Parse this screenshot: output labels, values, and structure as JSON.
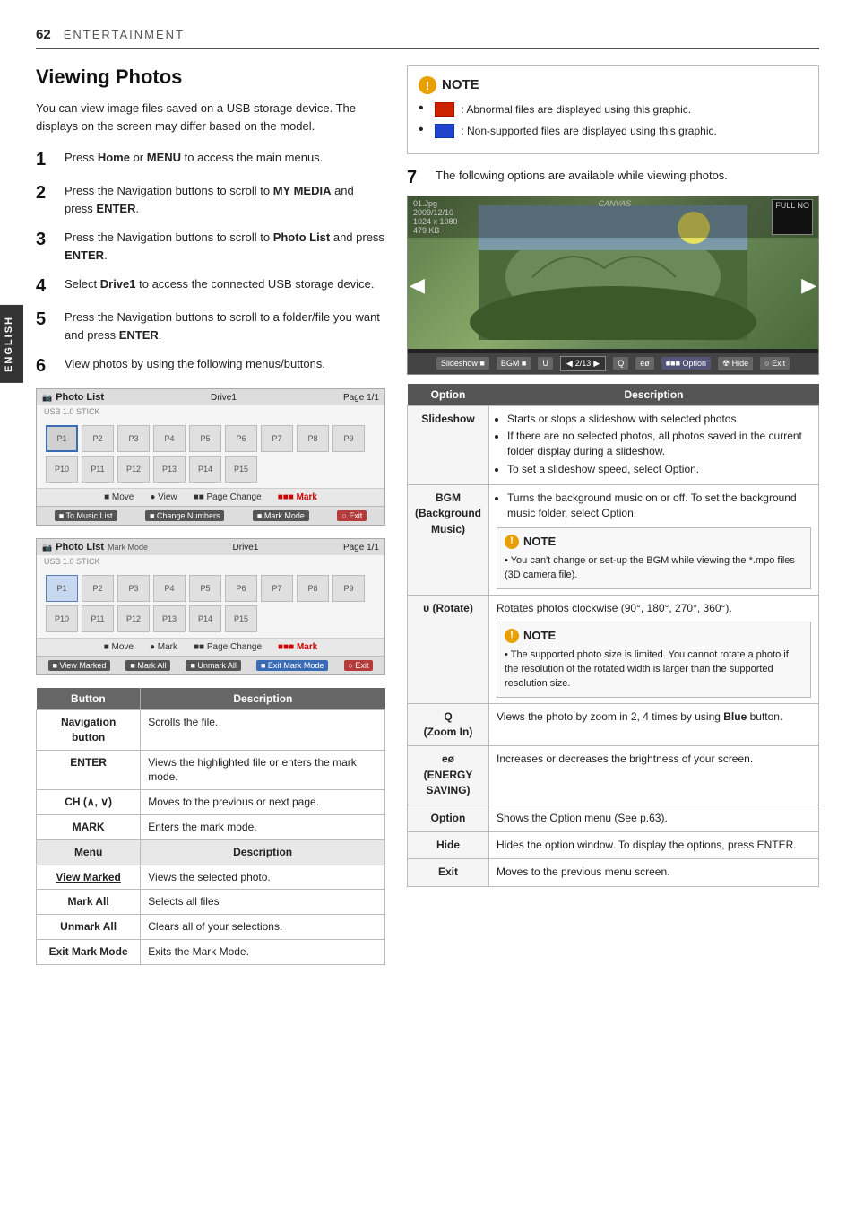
{
  "page": {
    "number": "62",
    "section": "ENTERTAINMENT",
    "english_tab": "ENGLISH"
  },
  "heading": "Viewing Photos",
  "intro": "You can view image files saved on a USB storage device. The displays on the screen may differ based on the model.",
  "steps": [
    {
      "num": "1",
      "text": "Press Home or MENU to access the main menus."
    },
    {
      "num": "2",
      "text": "Press the Navigation buttons to scroll to MY MEDIA and press ENTER."
    },
    {
      "num": "3",
      "text": "Press the Navigation buttons to scroll to Photo List and press ENTER."
    },
    {
      "num": "4",
      "text": "Select Drive1 to access the connected USB storage device."
    },
    {
      "num": "5",
      "text": "Press the Navigation buttons to scroll to a folder/file you want and press ENTER."
    },
    {
      "num": "6",
      "text": "View photos by using the following menus/buttons."
    }
  ],
  "photo_list_ui": {
    "title": "Photo List",
    "mode_label": "Mark Mode",
    "drive": "Drive1",
    "page": "Page 1/1",
    "thumbs": [
      "P1",
      "P2",
      "P3",
      "P4",
      "P5",
      "P6",
      "P7",
      "P8",
      "P9",
      "P10",
      "P11",
      "P12",
      "P13",
      "P14",
      "P15"
    ],
    "nav_items": [
      "Move",
      "View",
      "Page Change",
      "Mark"
    ],
    "buttons_1": [
      "To Music List",
      "Change Numbers",
      "Mark Mode",
      "Exit"
    ],
    "buttons_2": [
      "View Marked",
      "Mark All",
      "Unmark All",
      "Exit Mark Mode",
      "Exit"
    ]
  },
  "button_table": {
    "col1": "Button",
    "col2": "Description",
    "rows": [
      {
        "button": "Navigation button",
        "desc": "Scrolls the file."
      },
      {
        "button": "ENTER",
        "desc": "Views the highlighted file or enters the mark mode."
      },
      {
        "button": "CH (∧, ∨)",
        "desc": "Moves to the previous or next page."
      },
      {
        "button": "MARK",
        "desc": "Enters the mark mode."
      }
    ],
    "menu_col1": "Menu",
    "menu_col2": "Description",
    "menu_rows": [
      {
        "menu": "View Marked",
        "desc": "Views the selected photo."
      },
      {
        "menu": "Mark All",
        "desc": "Selects all files"
      },
      {
        "menu": "Unmark All",
        "desc": "Clears all of your selections."
      },
      {
        "menu": "Exit Mark Mode",
        "desc": "Exits the Mark Mode."
      }
    ]
  },
  "note": {
    "title": "NOTE",
    "bullets": [
      "Abnormal files are displayed using this graphic.",
      "Non-supported files are displayed using this graphic."
    ]
  },
  "step7_text": "The following options are available while viewing photos.",
  "viewer": {
    "file_info": "01.Jpg\n2009/12/10\n1024 x 1080\n479 KB",
    "counter": "2/13",
    "toolbar_items": [
      "Slideshow",
      "BGM",
      "U",
      "Q",
      "eø",
      "Option",
      "Hide",
      "Exit"
    ],
    "full_no": "FULL NO",
    "canvas_text": "CANVAS"
  },
  "options_table": {
    "col1": "Option",
    "col2": "Description",
    "rows": [
      {
        "option": "Slideshow",
        "desc_bullets": [
          "Starts or stops a slideshow with selected photos.",
          "If there are no selected photos, all photos saved in the current folder display during a slideshow.",
          "To set a slideshow speed, select Option."
        ]
      },
      {
        "option": "BGM\n(Background\nMusic)",
        "desc_bullets": [
          "Turns the background music on or off. To set the background music folder, select Option."
        ],
        "inner_note": "You can't change or set-up the BGM while viewing the *.mpo files (3D camera file)."
      },
      {
        "option": "υ (Rotate)",
        "desc_text": "Rotates photos clockwise (90°, 180°, 270°, 360°).",
        "inner_note": "The supported photo size is limited. You cannot rotate a photo if the resolution of the rotated width is larger than the supported resolution size."
      },
      {
        "option": "Q\n(Zoom In)",
        "desc_text": "Views the photo by zoom in 2, 4 times by using Blue button."
      },
      {
        "option": "eø\n(ENERGY\nSAVING)",
        "desc_text": "Increases or decreases the brightness of your screen."
      },
      {
        "option": "Option",
        "desc_text": "Shows the Option menu (See p.63)."
      },
      {
        "option": "Hide",
        "desc_text": "Hides the option window. To display the options, press ENTER."
      },
      {
        "option": "Exit",
        "desc_text": "Moves to the previous menu screen."
      }
    ]
  }
}
